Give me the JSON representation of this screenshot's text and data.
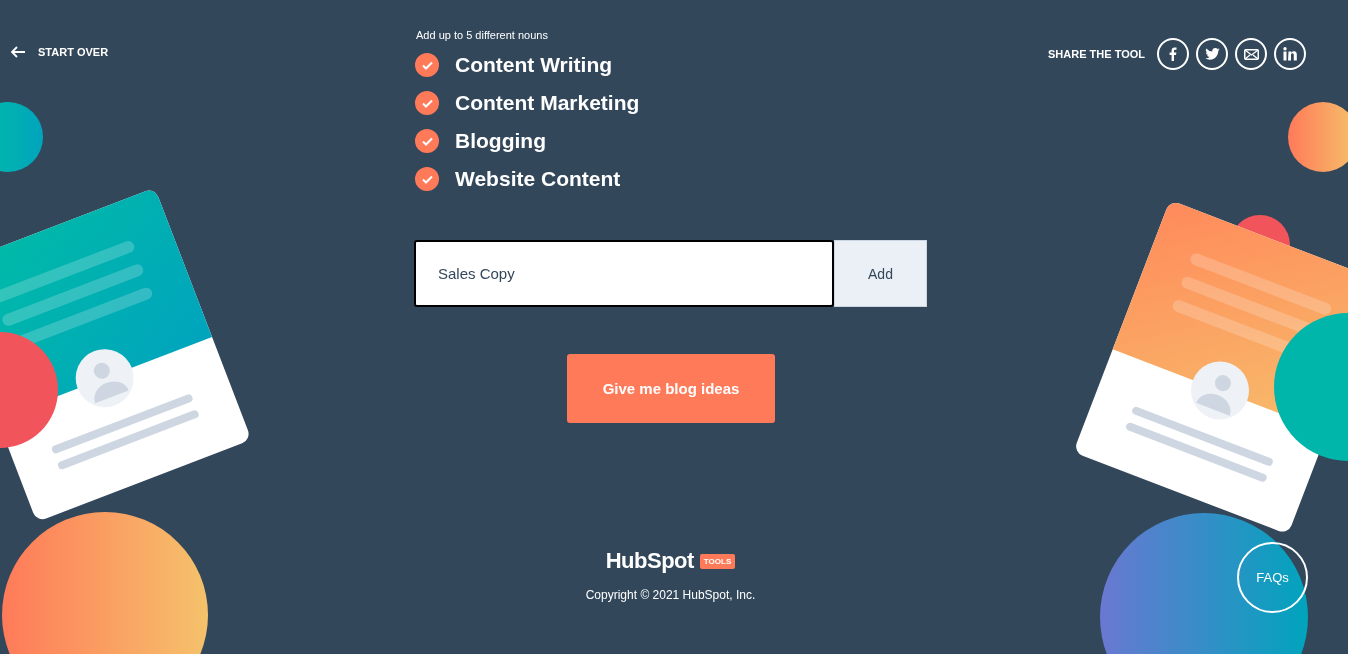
{
  "nav": {
    "back_label": "START OVER"
  },
  "share": {
    "label": "SHARE THE TOOL",
    "buttons": [
      {
        "kind": "facebook"
      },
      {
        "kind": "twitter"
      },
      {
        "kind": "email"
      },
      {
        "kind": "linkedin"
      }
    ]
  },
  "nouns": {
    "hint": "Add up to 5 different nouns",
    "items": [
      {
        "label": "Content Writing",
        "checked": true
      },
      {
        "label": "Content Marketing",
        "checked": true
      },
      {
        "label": "Blogging",
        "checked": true
      },
      {
        "label": "Website Content",
        "checked": true
      }
    ]
  },
  "noun_input": {
    "value": "Sales Copy",
    "button": "Add"
  },
  "submit_button": "Give me blog ideas",
  "footer": {
    "logo": "HubSpot",
    "logo_badge": "TOOLS",
    "copyright": "Copyright © 2021 HubSpot, Inc."
  },
  "faq_button": "FAQs"
}
